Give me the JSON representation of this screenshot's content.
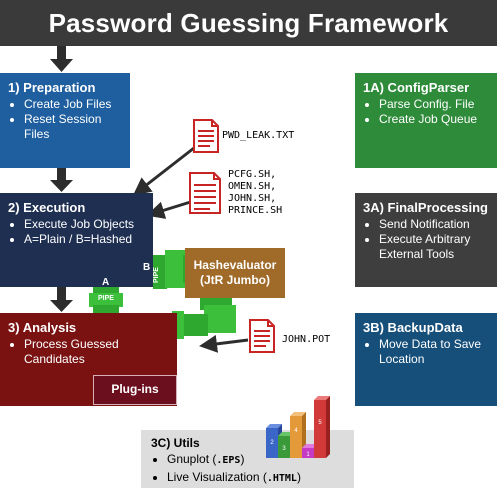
{
  "title": "Password Guessing Framework",
  "colors": {
    "header": "#3a3a3a",
    "preparation": "#1f5fa0",
    "execution": "#1e2f52",
    "analysis": "#7a1212",
    "configparser": "#2e8b3a",
    "finalprocessing": "#3e3e3e",
    "backupdata": "#164f7a",
    "hashevaluator": "#a06a28",
    "pipe": "#2fa82f",
    "arrow": "#2d2d2d",
    "document": "#c82424"
  },
  "preparation": {
    "title": "1) Preparation",
    "items": [
      "Create Job Files",
      "Reset Session Files"
    ]
  },
  "configparser": {
    "title": "1A) ConfigParser",
    "items": [
      "Parse Config. File",
      "Create Job Queue"
    ]
  },
  "execution": {
    "title": "2) Execution",
    "items": [
      "Execute Job Objects",
      "A=Plain / B=Hashed"
    ]
  },
  "finalprocessing": {
    "title": "3A) FinalProcessing",
    "items": [
      "Send Notification",
      "Execute Arbitrary External Tools"
    ]
  },
  "analysis": {
    "title": "3) Analysis",
    "items": [
      "Process Guessed Candidates"
    ],
    "plugins": "Plug-ins"
  },
  "backupdata": {
    "title": "3B) BackupData",
    "items": [
      "Move Data to Save Location"
    ]
  },
  "hashevaluator": {
    "line1": "Hashevaluator",
    "line2": "(JtR Jumbo)"
  },
  "pwd_leak_file": "PWD_LEAK.TXT",
  "script_files": [
    "PCFG.SH,",
    "OMEN.SH,",
    "JOHN.SH,",
    "PRINCE.SH"
  ],
  "john_pot_file": "JOHN.POT",
  "pipe_labels": {
    "a": "A",
    "b": "B",
    "pipe": "PIPE"
  },
  "utils": {
    "title": "3C) Utils",
    "items": [
      {
        "text": "Gnuplot (",
        "code": ".EPS",
        "after": ")"
      },
      {
        "text": "Live Visualization (",
        "code": ".HTML",
        "after": ")"
      }
    ]
  },
  "chart_icon": {
    "labels": [
      "6",
      "5",
      "4",
      "3",
      "2",
      "1"
    ]
  }
}
